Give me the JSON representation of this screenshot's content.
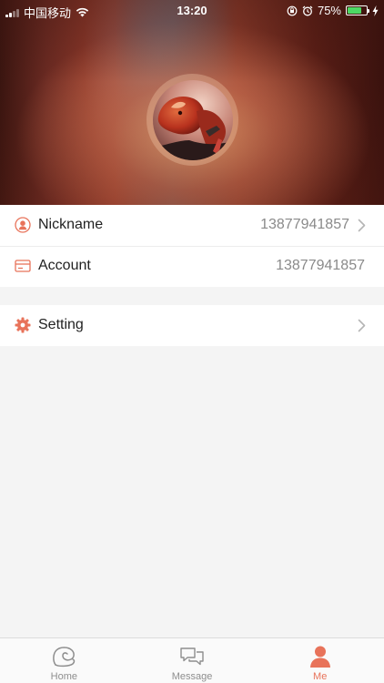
{
  "status_bar": {
    "carrier": "中国移动",
    "time": "13:20",
    "battery_percent": "75%",
    "battery_level": 0.75
  },
  "profile": {
    "avatar_icon": "avatar-image"
  },
  "list_group_1": {
    "items": [
      {
        "label": "Nickname",
        "value": "13877941857",
        "icon": "user-icon",
        "has_arrow": true
      },
      {
        "label": "Account",
        "value": "13877941857",
        "icon": "card-icon",
        "has_arrow": false
      }
    ]
  },
  "list_group_2": {
    "items": [
      {
        "label": "Setting",
        "icon": "gear-icon",
        "has_arrow": true
      }
    ]
  },
  "tabbar": {
    "tabs": [
      {
        "label": "Home",
        "icon": "home-icon",
        "active": false
      },
      {
        "label": "Message",
        "icon": "message-icon",
        "active": false
      },
      {
        "label": "Me",
        "icon": "me-icon",
        "active": true
      }
    ]
  },
  "colors": {
    "accent": "#e8735a",
    "icon_gray": "#8e8e8e",
    "value_gray": "#8a8a8a"
  }
}
